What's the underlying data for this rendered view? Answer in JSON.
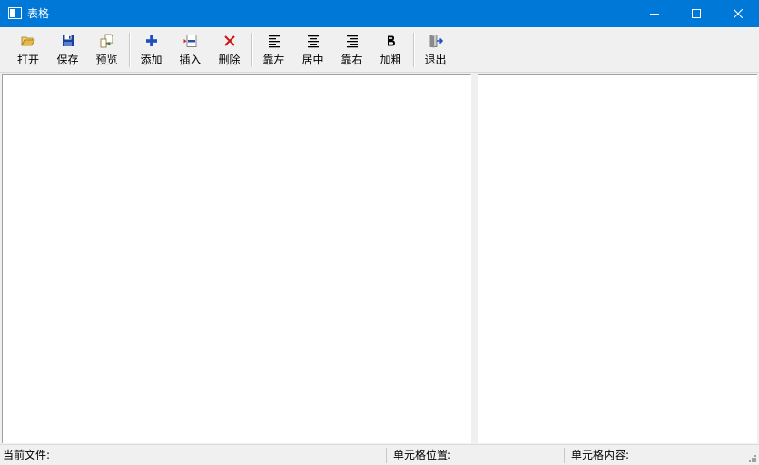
{
  "window": {
    "title": "表格"
  },
  "toolbar": {
    "buttons": [
      {
        "id": "open",
        "label": "打开",
        "icon": "folder-open-icon"
      },
      {
        "id": "save",
        "label": "保存",
        "icon": "floppy-disk-icon"
      },
      {
        "id": "preview",
        "label": "预览",
        "icon": "preview-icon"
      },
      {
        "id": "add",
        "label": "添加",
        "icon": "plus-icon"
      },
      {
        "id": "insert",
        "label": "插入",
        "icon": "insert-row-icon"
      },
      {
        "id": "delete",
        "label": "删除",
        "icon": "red-x-icon"
      },
      {
        "id": "align-left",
        "label": "靠左",
        "icon": "align-left-icon"
      },
      {
        "id": "align-center",
        "label": "居中",
        "icon": "align-center-icon"
      },
      {
        "id": "align-right",
        "label": "靠右",
        "icon": "align-right-icon"
      },
      {
        "id": "bold",
        "label": "加粗",
        "icon": "bold-icon"
      },
      {
        "id": "exit",
        "label": "退出",
        "icon": "exit-door-icon"
      }
    ]
  },
  "statusbar": {
    "current_file": "当前文件:",
    "cell_position": "单元格位置:",
    "cell_content": "单元格内容:"
  },
  "colors": {
    "titlebar": "#0078d7",
    "add_icon": "#1f4fbf",
    "delete_icon": "#d01010",
    "save_icon": "#1a3f9a",
    "folder_icon": "#e8b73c"
  }
}
